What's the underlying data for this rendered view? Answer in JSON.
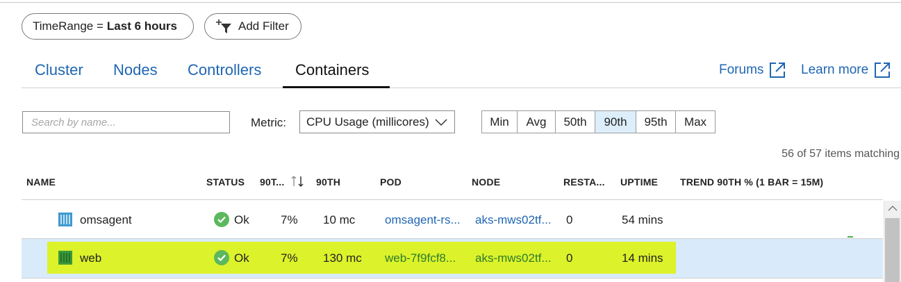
{
  "filters": {
    "time_range_key": "TimeRange =",
    "time_range_value": "Last 6 hours",
    "add_filter_label": "Add Filter"
  },
  "tabs": [
    {
      "label": "Cluster",
      "active": false
    },
    {
      "label": "Nodes",
      "active": false
    },
    {
      "label": "Controllers",
      "active": false
    },
    {
      "label": "Containers",
      "active": true
    }
  ],
  "links": {
    "forums": "Forums",
    "learn_more": "Learn more"
  },
  "toolbar": {
    "search_placeholder": "Search by name...",
    "metric_label": "Metric:",
    "metric_value": "CPU Usage (millicores)",
    "percentiles": [
      {
        "label": "Min",
        "selected": false
      },
      {
        "label": "Avg",
        "selected": false
      },
      {
        "label": "50th",
        "selected": false
      },
      {
        "label": "90th",
        "selected": true
      },
      {
        "label": "95th",
        "selected": false
      },
      {
        "label": "Max",
        "selected": false
      }
    ]
  },
  "matching_text": "56 of 57 items matching",
  "table": {
    "columns": [
      "NAME",
      "STATUS",
      "90T...",
      "90TH",
      "POD",
      "NODE",
      "RESTA...",
      "UPTIME",
      "TREND 90TH % (1 BAR = 15M)"
    ],
    "rows": [
      {
        "name": "omsagent",
        "status": "Ok",
        "percent": "7%",
        "value": "10 mc",
        "pod": "omsagent-rs...",
        "node": "aks-mws02tf...",
        "restarts": "0",
        "uptime": "54 mins"
      },
      {
        "name": "web",
        "status": "Ok",
        "percent": "7%",
        "value": "130 mc",
        "pod": "web-7f9fcf8...",
        "node": "aks-mws02tf...",
        "restarts": "0",
        "uptime": "14 mins"
      }
    ]
  },
  "colors": {
    "link": "#1f66b3",
    "selected_row": "#d9ebfa",
    "highlight": "#dcf22a",
    "status_ok": "#5cb85c"
  }
}
